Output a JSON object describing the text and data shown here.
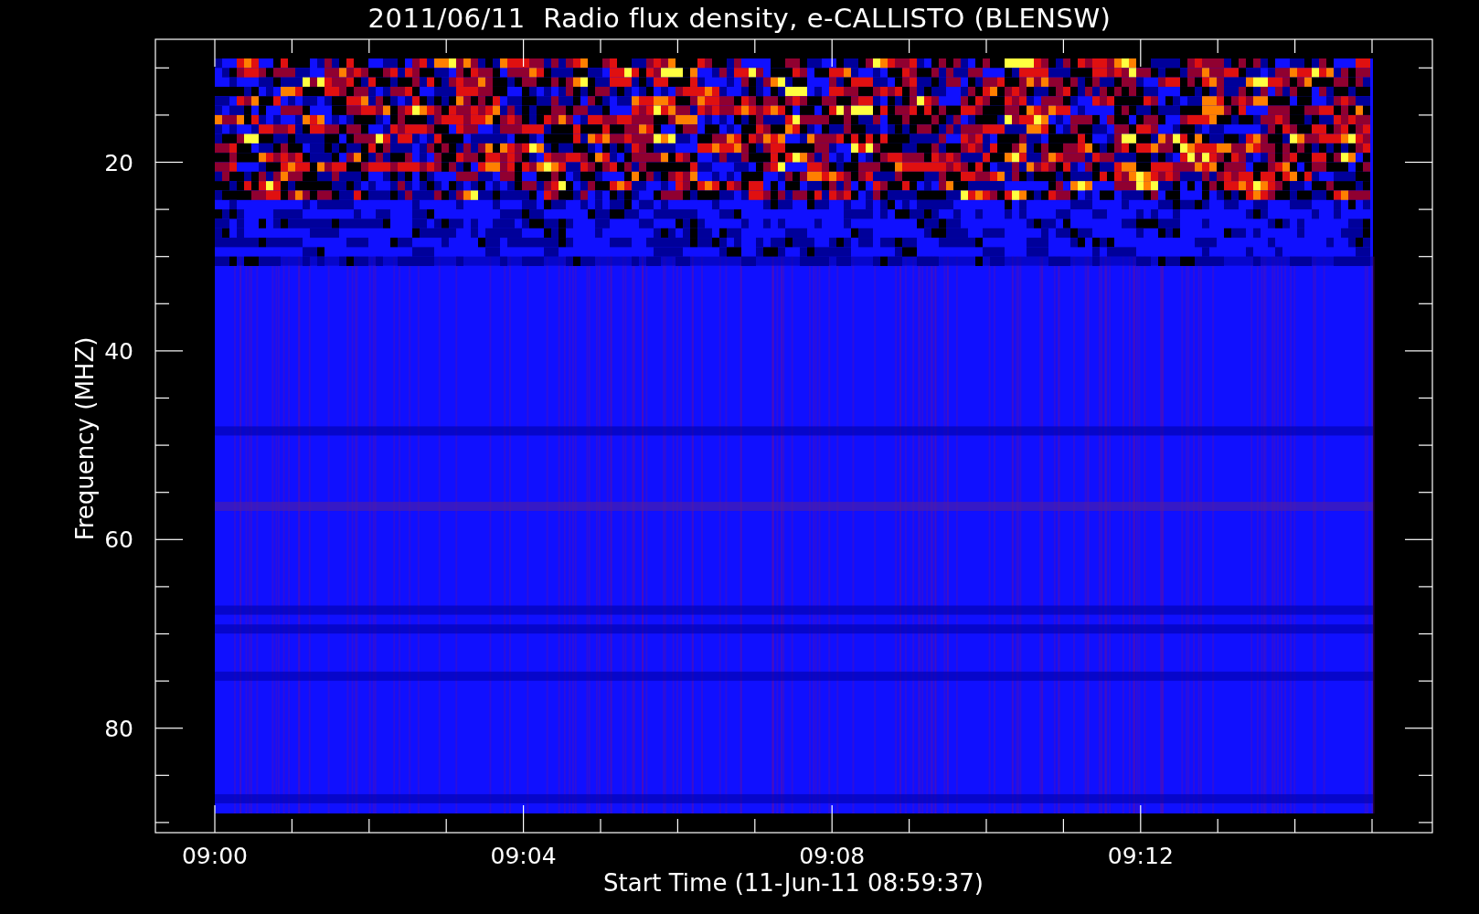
{
  "title": "2011/06/11  Radio flux density, e-CALLISTO (BLENSW)",
  "y_axis": {
    "label": "Frequency (MHZ)",
    "ticks": [
      "20",
      "40",
      "60",
      "80"
    ]
  },
  "x_axis": {
    "label": "Start Time (11-Jun-11 08:59:37)",
    "ticks": [
      "09:00",
      "09:04",
      "09:08",
      "09:12"
    ]
  }
}
